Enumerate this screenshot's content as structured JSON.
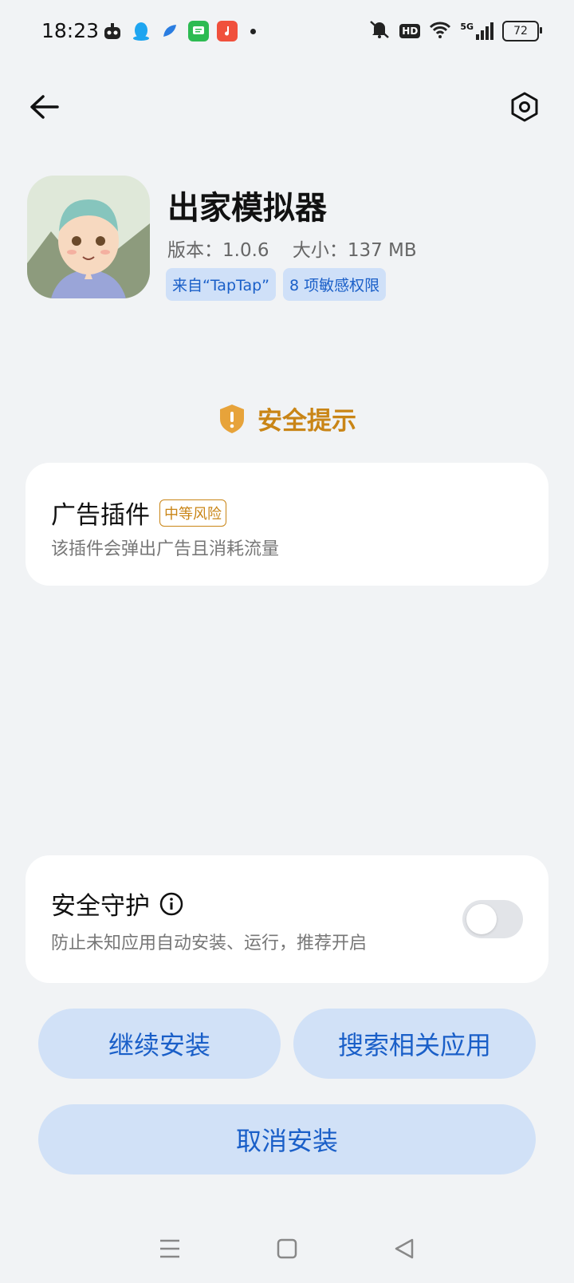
{
  "status_bar": {
    "time": "18:23",
    "notification_icons": [
      "robot-icon",
      "qq-icon",
      "feather-icon",
      "message-icon",
      "music-icon"
    ],
    "hd_label": "HD",
    "signal_label": "5G",
    "battery": "72"
  },
  "app": {
    "name": "出家模拟器",
    "version": "版本：1.0.6",
    "size": "大小：137 MB",
    "badges": [
      "来自“TapTap”",
      "8 项敏感权限"
    ]
  },
  "safety": {
    "title": "安全提示",
    "ad_plugin_title": "广告插件",
    "risk_level": "中等风险",
    "ad_plugin_desc": "该插件会弹出广告且消耗流量"
  },
  "guard": {
    "title": "安全守护",
    "desc": "防止未知应用自动安装、运行，推荐开启",
    "enabled": false
  },
  "buttons": {
    "continue": "继续安装",
    "search": "搜索相关应用",
    "cancel": "取消安装"
  },
  "colors": {
    "accent": "#1a5fc8",
    "warning": "#c98516",
    "button_bg": "#d1e1f7",
    "page_bg": "#f1f3f5"
  }
}
